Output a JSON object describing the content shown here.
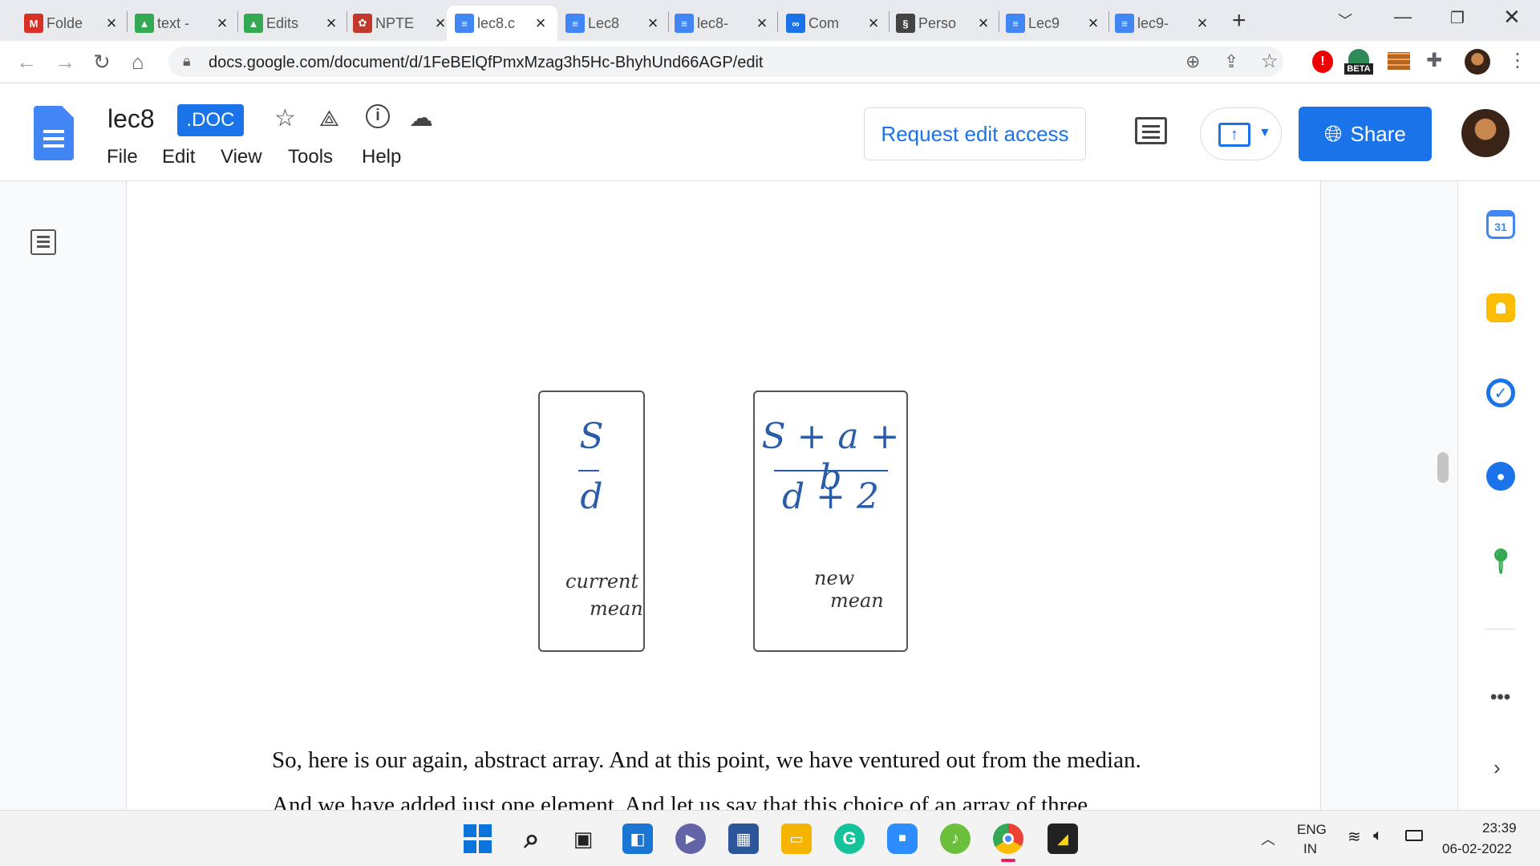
{
  "browser": {
    "tabs": [
      {
        "title": "Folde",
        "icon": "gmail-icon",
        "color": "#d93025",
        "glyph": "M"
      },
      {
        "title": "text -",
        "icon": "drive-icon",
        "color": "#34a853",
        "glyph": "▲"
      },
      {
        "title": "Edits",
        "icon": "drive-icon",
        "color": "#34a853",
        "glyph": "▲"
      },
      {
        "title": "NPTE",
        "icon": "nptel-icon",
        "color": "#c0392b",
        "glyph": "✿"
      },
      {
        "title": "lec8.c",
        "icon": "docs-icon",
        "color": "#4285f4",
        "glyph": "≡"
      },
      {
        "title": "Lec8",
        "icon": "docs-icon",
        "color": "#4285f4",
        "glyph": "≡"
      },
      {
        "title": "lec8-",
        "icon": "docs-icon",
        "color": "#4285f4",
        "glyph": "≡"
      },
      {
        "title": "Com",
        "icon": "link-icon",
        "color": "#1a73e8",
        "glyph": "∞"
      },
      {
        "title": "Perso",
        "icon": "chain-icon",
        "color": "#444444",
        "glyph": "§"
      },
      {
        "title": "Lec9",
        "icon": "docs-icon",
        "color": "#4285f4",
        "glyph": "≡"
      },
      {
        "title": "lec9-",
        "icon": "docs-icon",
        "color": "#4285f4",
        "glyph": "≡"
      }
    ],
    "active_tab": 4,
    "url": "docs.google.com/document/d/1FeBElQfPmxMzag3h5Hc-BhyhUnd66AGP/edit",
    "beta_label": "BETA"
  },
  "doc": {
    "title": "lec8",
    "badge": ".DOC",
    "menus": [
      "File",
      "Edit",
      "View",
      "Tools",
      "Help"
    ],
    "request_label": "Request edit access",
    "share_label": "Share"
  },
  "content": {
    "card1": {
      "numerator": "S",
      "denominator": "d",
      "note_line1": "current",
      "note_line2": "mean"
    },
    "card2": {
      "numerator": "S + a + b",
      "denominator": "d + 2",
      "note_line1": "new",
      "note_line2": "mean"
    },
    "para1": "So, here is our again, abstract array. And at this point, we have ventured out from the median.",
    "para2": "And we have added just one element. And let us say that this choice of an array of three"
  },
  "side": {
    "calendar_day": "31"
  },
  "system": {
    "lang1": "ENG",
    "lang2": "IN",
    "time": "23:39",
    "date": "06-02-2022"
  }
}
